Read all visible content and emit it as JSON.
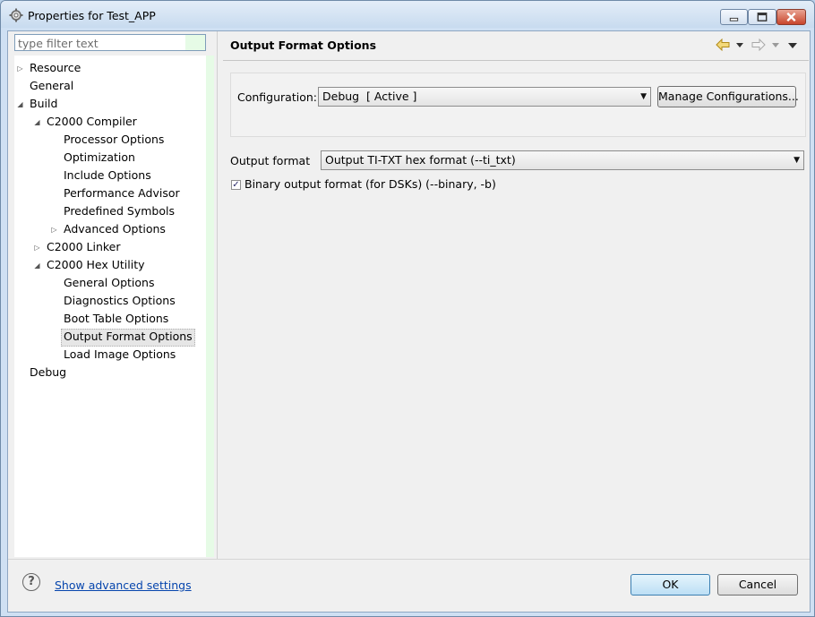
{
  "window": {
    "title": "Properties for Test_APP",
    "app_icon": "gear-app-icon",
    "controls": [
      "minimize-icon",
      "maximize-icon",
      "close-icon"
    ]
  },
  "sidebar": {
    "filter_placeholder": "type filter text",
    "tree": [
      {
        "label": "Resource",
        "expander": "collapsed"
      },
      {
        "label": "General",
        "expander": "none"
      },
      {
        "label": "Build",
        "expander": "expanded"
      },
      {
        "label": "C2000 Compiler",
        "expander": "expanded"
      },
      {
        "label": "Processor Options",
        "expander": "none"
      },
      {
        "label": "Optimization",
        "expander": "none"
      },
      {
        "label": "Include Options",
        "expander": "none"
      },
      {
        "label": "Performance Advisor",
        "expander": "none"
      },
      {
        "label": "Predefined Symbols",
        "expander": "none"
      },
      {
        "label": "Advanced Options",
        "expander": "collapsed"
      },
      {
        "label": "C2000 Linker",
        "expander": "collapsed"
      },
      {
        "label": "C2000 Hex Utility",
        "expander": "expanded"
      },
      {
        "label": "General Options",
        "expander": "none"
      },
      {
        "label": "Diagnostics Options",
        "expander": "none"
      },
      {
        "label": "Boot Table Options",
        "expander": "none"
      },
      {
        "label": "Output Format Options",
        "expander": "none",
        "selected": true
      },
      {
        "label": "Load Image Options",
        "expander": "none"
      },
      {
        "label": "Debug",
        "expander": "none"
      }
    ]
  },
  "main": {
    "title": "Output Format Options",
    "nav_icons": [
      "back-arrow-icon",
      "back-menu-icon",
      "forward-arrow-icon",
      "forward-menu-icon",
      "view-menu-icon"
    ],
    "configuration_label": "Configuration:",
    "configuration_value": "Debug  [ Active ]",
    "manage_button": "Manage Configurations...",
    "output_format_label": "Output format",
    "output_format_value": "Output TI-TXT hex format (--ti_txt)",
    "binary_checkbox_label": "Binary output format (for DSKs) (--binary, -b)",
    "binary_checked": true
  },
  "footer": {
    "help_icon": "help-icon",
    "show_advanced": "Show advanced settings",
    "ok": "OK",
    "cancel": "Cancel"
  }
}
